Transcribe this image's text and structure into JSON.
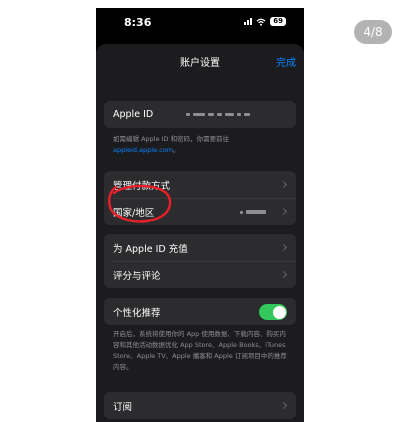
{
  "pager": {
    "label": "4/8"
  },
  "status_bar": {
    "time": "8:36",
    "battery": "69"
  },
  "nav": {
    "title": "账户设置",
    "done": "完成"
  },
  "apple_id": {
    "label": "Apple ID",
    "note_text": "如需编辑 Apple ID 和密码，你需要前往",
    "note_link": "appleid.apple.com",
    "note_end": "。"
  },
  "payment_group": {
    "manage_payment": "管理付款方式",
    "country_region": "国家/地区"
  },
  "balance_group": {
    "top_up": "为 Apple ID 充值",
    "ratings": "评分与评论"
  },
  "personalized": {
    "label": "个性化推荐",
    "enabled": true,
    "note": "开启后，系统将使用你的 App 使用数据、下载内容、购买内容和其他活动数据优化 App Store、Apple Books、iTunes Store、Apple TV、Apple 播客和 Apple 订阅项目中的推荐内容。"
  },
  "subscriptions": {
    "label": "订阅"
  },
  "colors": {
    "accent": "#0a84ff",
    "toggle_on": "#34c759",
    "annotation": "#e8202a"
  }
}
